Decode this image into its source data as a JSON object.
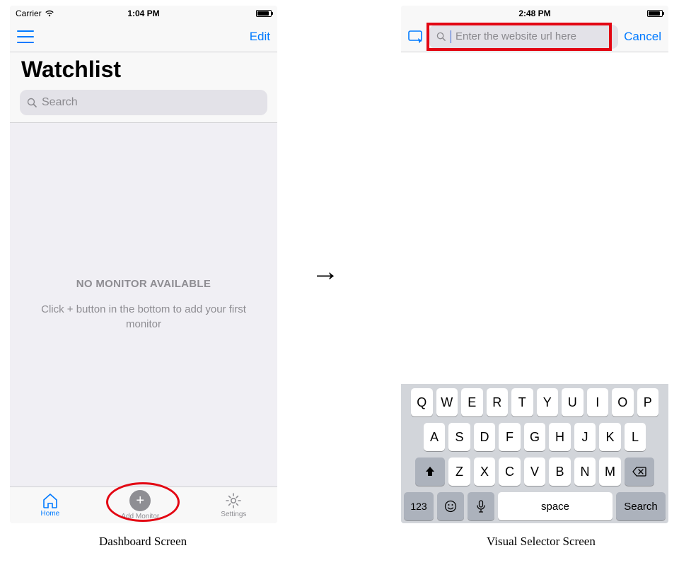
{
  "left": {
    "status": {
      "carrier": "Carrier",
      "time": "1:04 PM"
    },
    "nav": {
      "edit": "Edit"
    },
    "title": "Watchlist",
    "search_placeholder": "Search",
    "empty": {
      "title": "NO MONITOR AVAILABLE",
      "subtitle": "Click + button in the bottom to add your first monitor"
    },
    "tabs": {
      "home": "Home",
      "add": "Add Monitor",
      "settings": "Settings"
    },
    "caption": "Dashboard Screen"
  },
  "right": {
    "status": {
      "time": "2:48 PM"
    },
    "url_placeholder": "Enter the website url here",
    "cancel": "Cancel",
    "keyboard": {
      "row1": [
        "Q",
        "W",
        "E",
        "R",
        "T",
        "Y",
        "U",
        "I",
        "O",
        "P"
      ],
      "row2": [
        "A",
        "S",
        "D",
        "F",
        "G",
        "H",
        "J",
        "K",
        "L"
      ],
      "row3": [
        "Z",
        "X",
        "C",
        "V",
        "B",
        "N",
        "M"
      ],
      "k123": "123",
      "space": "space",
      "search": "Search"
    },
    "caption": "Visual Selector Screen"
  },
  "arrow": "→"
}
